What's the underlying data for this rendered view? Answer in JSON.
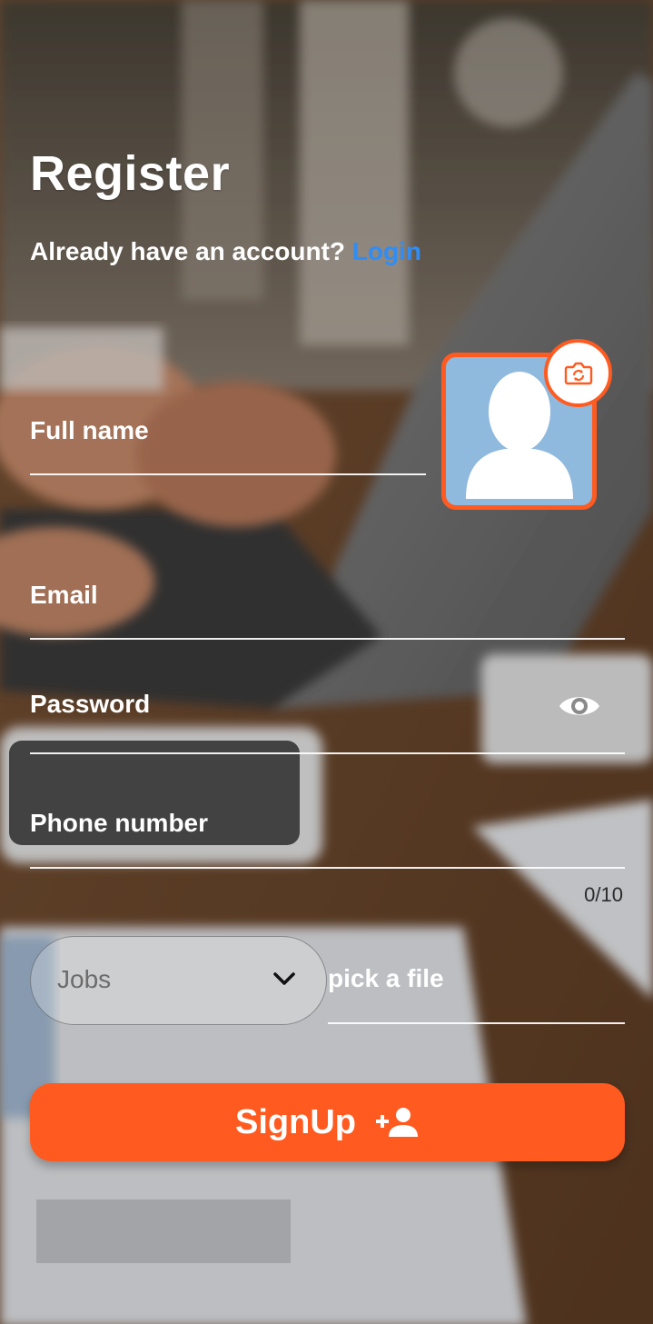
{
  "page": {
    "title": "Register",
    "subtitle": "Already have an account?",
    "login_link": "Login"
  },
  "form": {
    "full_name_label": "Full name",
    "email_label": "Email",
    "password_label": "Password",
    "phone_label": "Phone number",
    "phone_counter": "0/10",
    "jobs_placeholder": "Jobs",
    "file_label": "pick a file",
    "signup_label": "SignUp"
  },
  "icons": {
    "avatar": "user-silhouette-icon",
    "camera": "camera-flip-icon",
    "password_toggle": "eye-icon",
    "dropdown": "chevron-down-icon",
    "signup": "person-add-icon"
  },
  "colors": {
    "accent": "#ff5a1f",
    "link": "#2f8df5",
    "avatar_bg": "#8fb9dd"
  }
}
